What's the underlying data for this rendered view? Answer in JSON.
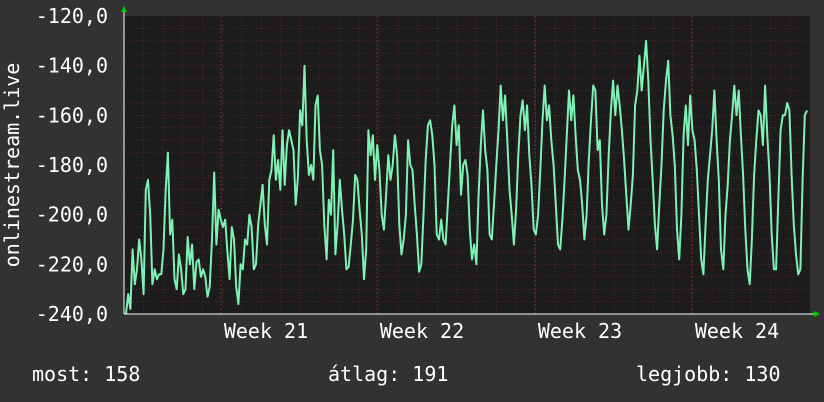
{
  "chart_data": {
    "type": "line",
    "ylabel": "onlinestream.live",
    "y_ticks": [
      -120,
      -140,
      -160,
      -180,
      -200,
      -220,
      -240
    ],
    "y_tick_labels": [
      "-120,0",
      "-140,0",
      "-160,0",
      "-180,0",
      "-200,0",
      "-220,0",
      "-240,0"
    ],
    "ylim": [
      -240,
      -120
    ],
    "x_tick_labels": [
      "Week 21",
      "Week 22",
      "Week 23",
      "Week 24"
    ],
    "grid": true,
    "colors": {
      "line": "#7ef2b4",
      "plot_bg": "#1c1c1c",
      "grid": "#7a2a2a",
      "axis_arrow": "#00cc00"
    },
    "series": [
      {
        "values": [
          -240,
          -232,
          -238,
          -214,
          -228,
          -222,
          -210,
          -218,
          -232,
          -190,
          -186,
          -200,
          -228,
          -222,
          -226,
          -224,
          -224,
          -214,
          -190,
          -175,
          -208,
          -202,
          -226,
          -230,
          -216,
          -222,
          -232,
          -230,
          -209,
          -220,
          -212,
          -230,
          -219,
          -218,
          -225,
          -222,
          -225,
          -233,
          -229,
          -210,
          -183,
          -212,
          -198,
          -202,
          -205,
          -202,
          -215,
          -226,
          -205,
          -210,
          -229,
          -236,
          -220,
          -222,
          -210,
          -212,
          -200,
          -205,
          -222,
          -220,
          -204,
          -196,
          -188,
          -204,
          -212,
          -186,
          -182,
          -168,
          -186,
          -178,
          -190,
          -166,
          -188,
          -172,
          -166,
          -170,
          -174,
          -196,
          -185,
          -158,
          -164,
          -140,
          -170,
          -184,
          -180,
          -186,
          -156,
          -152,
          -174,
          -180,
          -204,
          -218,
          -194,
          -200,
          -174,
          -216,
          -204,
          -186,
          -198,
          -208,
          -222,
          -221,
          -212,
          -202,
          -184,
          -186,
          -198,
          -208,
          -226,
          -214,
          -166,
          -176,
          -168,
          -186,
          -172,
          -182,
          -200,
          -206,
          -192,
          -176,
          -186,
          -180,
          -168,
          -176,
          -204,
          -216,
          -210,
          -200,
          -170,
          -180,
          -182,
          -196,
          -208,
          -223,
          -220,
          -200,
          -178,
          -164,
          -162,
          -168,
          -180,
          -208,
          -210,
          -202,
          -210,
          -212,
          -196,
          -180,
          -164,
          -156,
          -172,
          -164,
          -192,
          -180,
          -178,
          -184,
          -206,
          -218,
          -212,
          -220,
          -192,
          -172,
          -158,
          -174,
          -182,
          -208,
          -210,
          -196,
          -180,
          -166,
          -148,
          -162,
          -152,
          -170,
          -190,
          -200,
          -212,
          -198,
          -176,
          -160,
          -154,
          -166,
          -156,
          -176,
          -188,
          -206,
          -208,
          -200,
          -182,
          -162,
          -148,
          -162,
          -156,
          -170,
          -180,
          -196,
          -212,
          -214,
          -202,
          -186,
          -168,
          -150,
          -162,
          -152,
          -168,
          -182,
          -186,
          -196,
          -210,
          -200,
          -178,
          -162,
          -148,
          -150,
          -174,
          -170,
          -196,
          -208,
          -200,
          -176,
          -158,
          -146,
          -160,
          -148,
          -156,
          -166,
          -178,
          -192,
          -206,
          -196,
          -184,
          -156,
          -150,
          -136,
          -150,
          -140,
          -130,
          -146,
          -170,
          -186,
          -204,
          -214,
          -196,
          -180,
          -158,
          -146,
          -138,
          -160,
          -168,
          -180,
          -206,
          -218,
          -200,
          -168,
          -156,
          -172,
          -152,
          -166,
          -170,
          -182,
          -200,
          -218,
          -224,
          -204,
          -186,
          -176,
          -166,
          -150,
          -170,
          -186,
          -214,
          -222,
          -200,
          -188,
          -170,
          -160,
          -148,
          -160,
          -150,
          -168,
          -184,
          -206,
          -222,
          -228,
          -210,
          -184,
          -170,
          -158,
          -160,
          -172,
          -148,
          -168,
          -184,
          -208,
          -222,
          -222,
          -194,
          -166,
          -160,
          -160,
          -155,
          -158,
          -184,
          -204,
          -216,
          -224,
          -222,
          -186,
          -160,
          -158
        ]
      }
    ]
  },
  "stats": {
    "current": "most: 158",
    "average": "átlag: 191",
    "max": "legjobb: 130"
  }
}
